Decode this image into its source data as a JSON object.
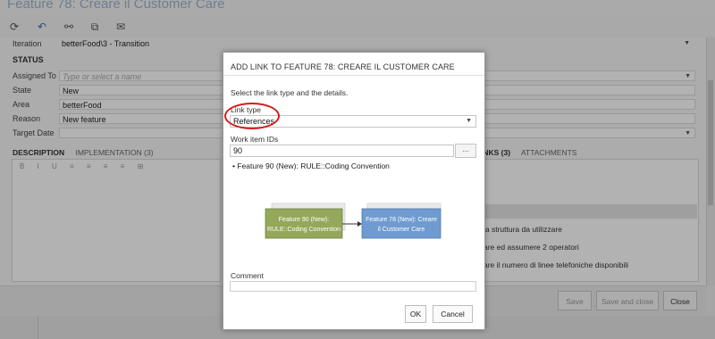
{
  "window": {
    "title": "Feature 78: Creare il Customer Care"
  },
  "toolbar": {
    "icons": [
      "refresh-icon",
      "undo-icon",
      "link-icon",
      "copy-icon",
      "mail-icon"
    ]
  },
  "form": {
    "iteration_label": "Iteration",
    "iteration_value": "betterFood\\3 - Transition",
    "status_heading": "STATUS",
    "assigned_label": "Assigned To",
    "assigned_placeholder": "Type or select a name",
    "state_label": "State",
    "state_value": "New",
    "area_label": "Area",
    "area_value": "betterFood",
    "reason_label": "Reason",
    "reason_value": "New feature",
    "target_label": "Target Date",
    "tabs": {
      "description": "DESCRIPTION",
      "implementation": "IMPLEMENTATION (3)"
    },
    "right_tabs": {
      "links": "LINKS (3)",
      "attachments": "ATTACHMENTS"
    },
    "links_fragment": "INKS (3)",
    "editor_tools": "B I U ≡ ≡ ≡ ≡ ⊞",
    "right_lines": [
      "la struttura da utilizzare",
      "are ed assumere 2 operatori",
      "are il numero di linee telefoniche disponibili"
    ]
  },
  "footer": {
    "save": "Save",
    "save_close": "Save and close",
    "close": "Close"
  },
  "dialog": {
    "title": "ADD LINK TO FEATURE 78: CREARE IL CUSTOMER CARE",
    "instruction": "Select the link type and the details.",
    "link_type_label": "Link type",
    "link_type_value": "References",
    "work_item_ids_label": "Work item IDs",
    "work_item_ids_value": "90",
    "browse_label": "...",
    "result_item": "Feature 90 (New): RULE::Coding Convention",
    "diagram": {
      "source": {
        "line1": "Feature 90 (New):",
        "line2": "RULE::Coding Convention"
      },
      "target": {
        "line1": "Feature 78 (New): Creare",
        "line2": "il Customer Care"
      }
    },
    "comment_label": "Comment",
    "ok_label": "OK",
    "cancel_label": "Cancel"
  },
  "colors": {
    "source_box": "#93a85a",
    "target_box": "#6f9bd0",
    "highlight_circle": "#d21c1c"
  }
}
